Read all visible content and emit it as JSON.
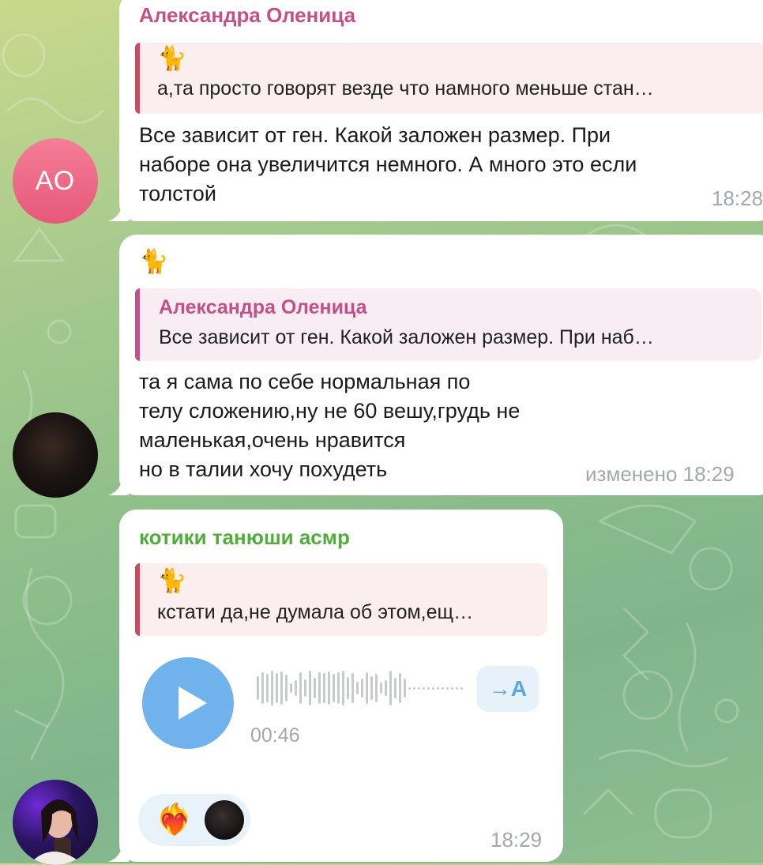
{
  "messages": [
    {
      "avatar_initials": "АО",
      "sender": "Александра Оленица",
      "sender_color": "#c4508a",
      "reply": {
        "sticker": "🐈",
        "text": "а,та просто говорят везде что намного меньше стан…",
        "bar_color": "#d1465c",
        "bg_color": "#fbeeee"
      },
      "text": "Все зависит от ген. Какой заложен размер. При\nнаборе она увеличится немного. А много это если\nтолстой",
      "time": "18:28"
    },
    {
      "sender_sticker": "🐈",
      "reply": {
        "sender": "Александра Оленица",
        "sender_color": "#c4508a",
        "text": "Все зависит от ген. Какой заложен размер. При наб…",
        "bar_color": "#c4508a",
        "bg_color": "#f8edf3"
      },
      "text": "та я сама по себе нормальная по\nтелу сложению,ну не 60 вешу,грудь не\nмаленькая,очень нравится\nно в талии хочу похудеть",
      "edited_label": "изменено",
      "time": "18:29"
    },
    {
      "sender": "котики танюши асмр",
      "sender_color": "#4fae3a",
      "reply": {
        "sticker": "🐈",
        "text": "кстати да,не думала об этом,ещ…",
        "bar_color": "#d1465c",
        "bg_color": "#fbeeee"
      },
      "voice": {
        "duration": "00:46",
        "transcribe_label": "→A",
        "accent_color": "#6fb2ec"
      },
      "reactions": {
        "emoji": "❤️‍🔥"
      },
      "time": "18:29"
    }
  ]
}
